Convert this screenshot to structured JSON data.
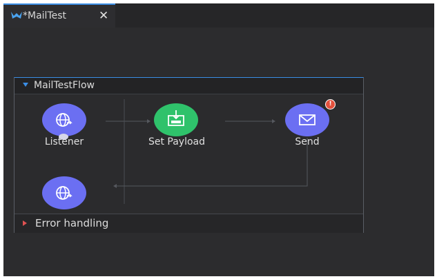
{
  "tab": {
    "label": "*MailTest",
    "close_glyph": "✕",
    "icon": "mule-logo-icon"
  },
  "flow": {
    "title": "MailTestFlow",
    "error_handling_label": "Error handling",
    "nodes": [
      {
        "id": "listener",
        "label": "Listener",
        "icon": "http-globe-icon",
        "color": "#6b6ff2"
      },
      {
        "id": "set-payload",
        "label": "Set Payload",
        "icon": "set-payload-icon",
        "color": "#2fc26b"
      },
      {
        "id": "send",
        "label": "Send",
        "icon": "envelope-icon",
        "color": "#6b6ff2",
        "has_error": true
      },
      {
        "id": "response",
        "label": "",
        "icon": "http-globe-icon",
        "color": "#6b6ff2"
      }
    ],
    "error_badge_glyph": "!"
  },
  "colors": {
    "accent": "#3a8ee6",
    "node_blue": "#6b6ff2",
    "node_green": "#2fc26b",
    "error_red": "#e2503c"
  }
}
